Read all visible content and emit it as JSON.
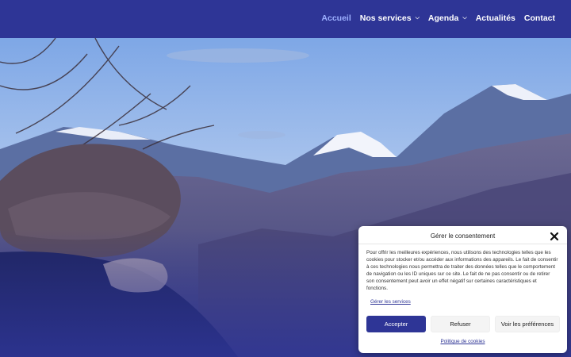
{
  "nav": {
    "items": [
      {
        "label": "Accueil",
        "active": true,
        "has_dropdown": false
      },
      {
        "label": "Nos services",
        "active": false,
        "has_dropdown": true
      },
      {
        "label": "Agenda",
        "active": false,
        "has_dropdown": true
      },
      {
        "label": "Actualités",
        "active": false,
        "has_dropdown": false
      },
      {
        "label": "Contact",
        "active": false,
        "has_dropdown": false
      }
    ]
  },
  "consent": {
    "title": "Gérer le consentement",
    "body": "Pour offrir les meilleures expériences, nous utilisons des technologies telles que les cookies pour stocker et/ou accéder aux informations des appareils. Le fait de consentir à ces technologies nous permettra de traiter des données telles que le comportement de navigation ou les ID uniques sur ce site. Le fait de ne pas consentir ou de retirer son consentement peut avoir un effet négatif sur certaines caractéristiques et fonctions.",
    "manage_services": "Gérer les services",
    "accept": "Accepter",
    "refuse": "Refuser",
    "preferences": "Voir les préférences",
    "policy": "Politique de cookies"
  },
  "colors": {
    "brand": "#2e3596",
    "active_link": "#9db0ff"
  },
  "icons": {
    "close": "close-icon",
    "dropdown": "chevron-down-icon"
  }
}
